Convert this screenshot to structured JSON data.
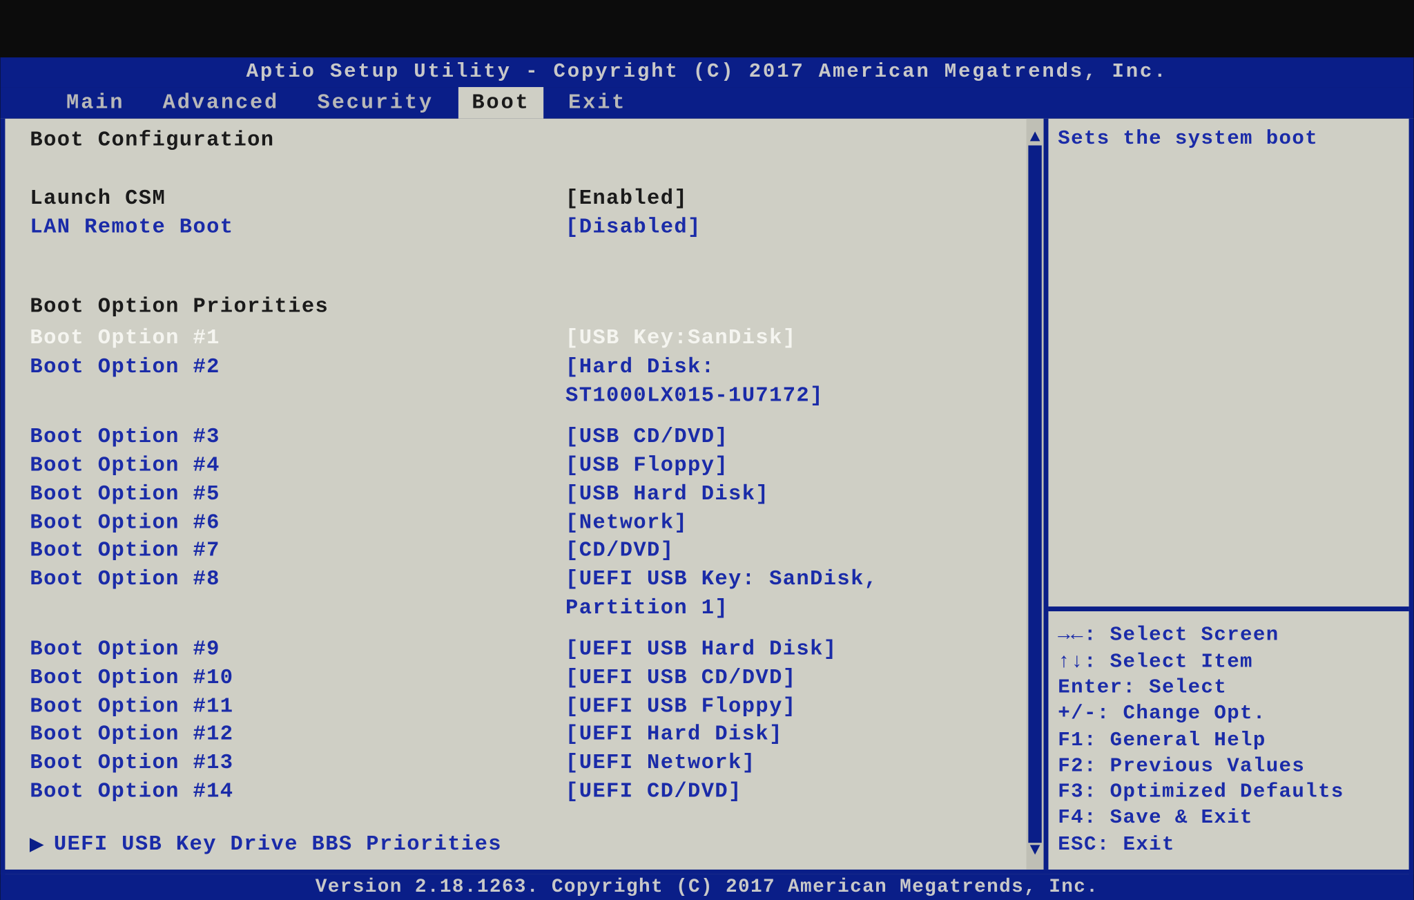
{
  "title": "Aptio Setup Utility - Copyright (C) 2017 American Megatrends, Inc.",
  "tabs": [
    "Main",
    "Advanced",
    "Security",
    "Boot",
    "Exit"
  ],
  "active_tab_index": 3,
  "left": {
    "section_title": "Boot Configuration",
    "launch_csm": {
      "label": "Launch CSM",
      "value": "[Enabled]"
    },
    "lan_remote": {
      "label": "LAN Remote Boot",
      "value": "[Disabled]"
    },
    "priorities_title": "Boot Option Priorities",
    "options": [
      {
        "label": "Boot Option #1",
        "value": "[USB Key:SanDisk]",
        "selected": true
      },
      {
        "label": "Boot Option #2",
        "value": "[Hard Disk: ST1000LX015-1U7172]"
      },
      {
        "label": "Boot Option #3",
        "value": "[USB CD/DVD]"
      },
      {
        "label": "Boot Option #4",
        "value": "[USB Floppy]"
      },
      {
        "label": "Boot Option #5",
        "value": "[USB Hard Disk]"
      },
      {
        "label": "Boot Option #6",
        "value": "[Network]"
      },
      {
        "label": "Boot Option #7",
        "value": "[CD/DVD]"
      },
      {
        "label": "Boot Option #8",
        "value": "[UEFI USB Key: SanDisk, Partition 1]"
      },
      {
        "label": "Boot Option #9",
        "value": "[UEFI USB Hard Disk]"
      },
      {
        "label": "Boot Option #10",
        "value": "[UEFI USB CD/DVD]"
      },
      {
        "label": "Boot Option #11",
        "value": "[UEFI USB Floppy]"
      },
      {
        "label": "Boot Option #12",
        "value": "[UEFI Hard Disk]"
      },
      {
        "label": "Boot Option #13",
        "value": "[UEFI Network]"
      },
      {
        "label": "Boot Option #14",
        "value": "[UEFI CD/DVD]"
      }
    ],
    "submenu": "UEFI USB Key Drive BBS Priorities"
  },
  "help_text": "Sets the system boot",
  "key_help": [
    "→←: Select Screen",
    "↑↓: Select Item",
    "Enter: Select",
    "+/-: Change Opt.",
    "F1: General Help",
    "F2: Previous Values",
    "F3: Optimized Defaults",
    "F4: Save & Exit",
    "ESC: Exit"
  ],
  "footer": "Version 2.18.1263. Copyright (C) 2017 American Megatrends, Inc."
}
